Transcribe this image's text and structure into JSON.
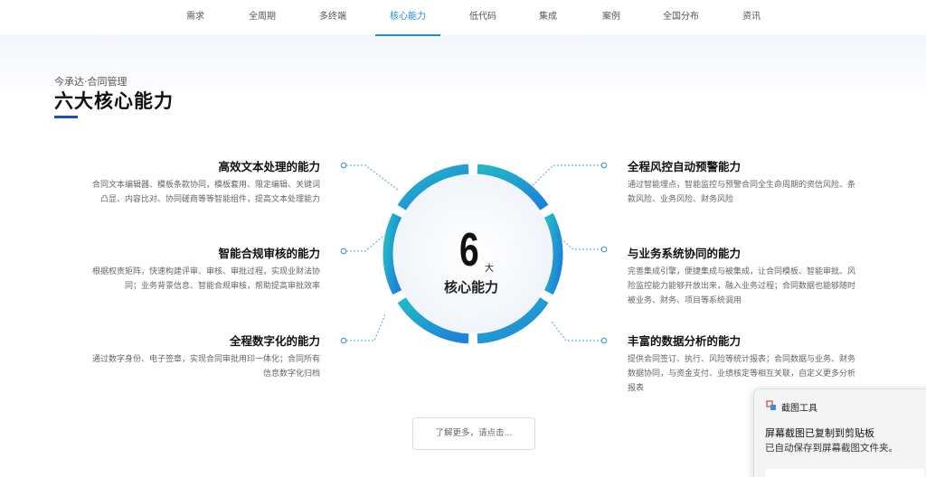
{
  "nav": {
    "items": [
      "需求",
      "全周期",
      "多终端",
      "核心能力",
      "低代码",
      "集成",
      "案例",
      "全国分布",
      "资讯"
    ],
    "active_index": 3
  },
  "section": {
    "breadcrumb": "今承达·合同管理",
    "title": "六大核心能力"
  },
  "center": {
    "number": "6",
    "unit": "大",
    "label": "核心能力"
  },
  "features": {
    "left": [
      {
        "title": "高效文本处理的能力",
        "desc1": "合同文本编辑器、模板条款协同，模板套用、限定编辑、关键词",
        "desc2": "凸显、内容比对、协同磋商等等智能组件，提高文本处理能力"
      },
      {
        "title": "智能合规审核的能力",
        "desc1": "根据权责矩阵，快速构建评审、审核、审批过程，实现业财法协",
        "desc2": "同；业务背景信息、智能合规审核，帮助提高审批效率"
      },
      {
        "title": "全程数字化的能力",
        "desc1": "通过数字身份、电子签章，实现合同审批用印一体化；合同所有",
        "desc2": "信息数字化归档"
      }
    ],
    "right": [
      {
        "title": "全程风控自动预警能力",
        "desc1": "通过智能埋点，智能监控与预警合同全生命周期的资信风险、条",
        "desc2": "款风险、业务风险、财务风险",
        "desc3": ""
      },
      {
        "title": "与业务系统协同的能力",
        "desc1": "完善集成引擎，便捷集成与被集成，让合同模板、智能审批、风",
        "desc2": "险监控能力能够开放出来，融入业务过程；合同数据也能够随时",
        "desc3": "被业务、财务、项目等系统调用"
      },
      {
        "title": "丰富的数据分析的能力",
        "desc1": "提供合同签订、执行、风险等统计报表；合同数据与业务、财务",
        "desc2": "数据协同，与资金支付、业绩核定等相互关联，自定义更多分析",
        "desc3": "报表"
      }
    ]
  },
  "more_button": "了解更多，请点击...",
  "toast": {
    "app": "截图工具",
    "line1": "屏幕截图已复制到剪贴板",
    "line2": "已自动保存到屏幕截图文件夹。"
  },
  "colors": {
    "accent": "#1a8fd6",
    "ring_start": "#22b3c9",
    "ring_end": "#1e7fd9",
    "title_bar": "#1d4fbf"
  }
}
